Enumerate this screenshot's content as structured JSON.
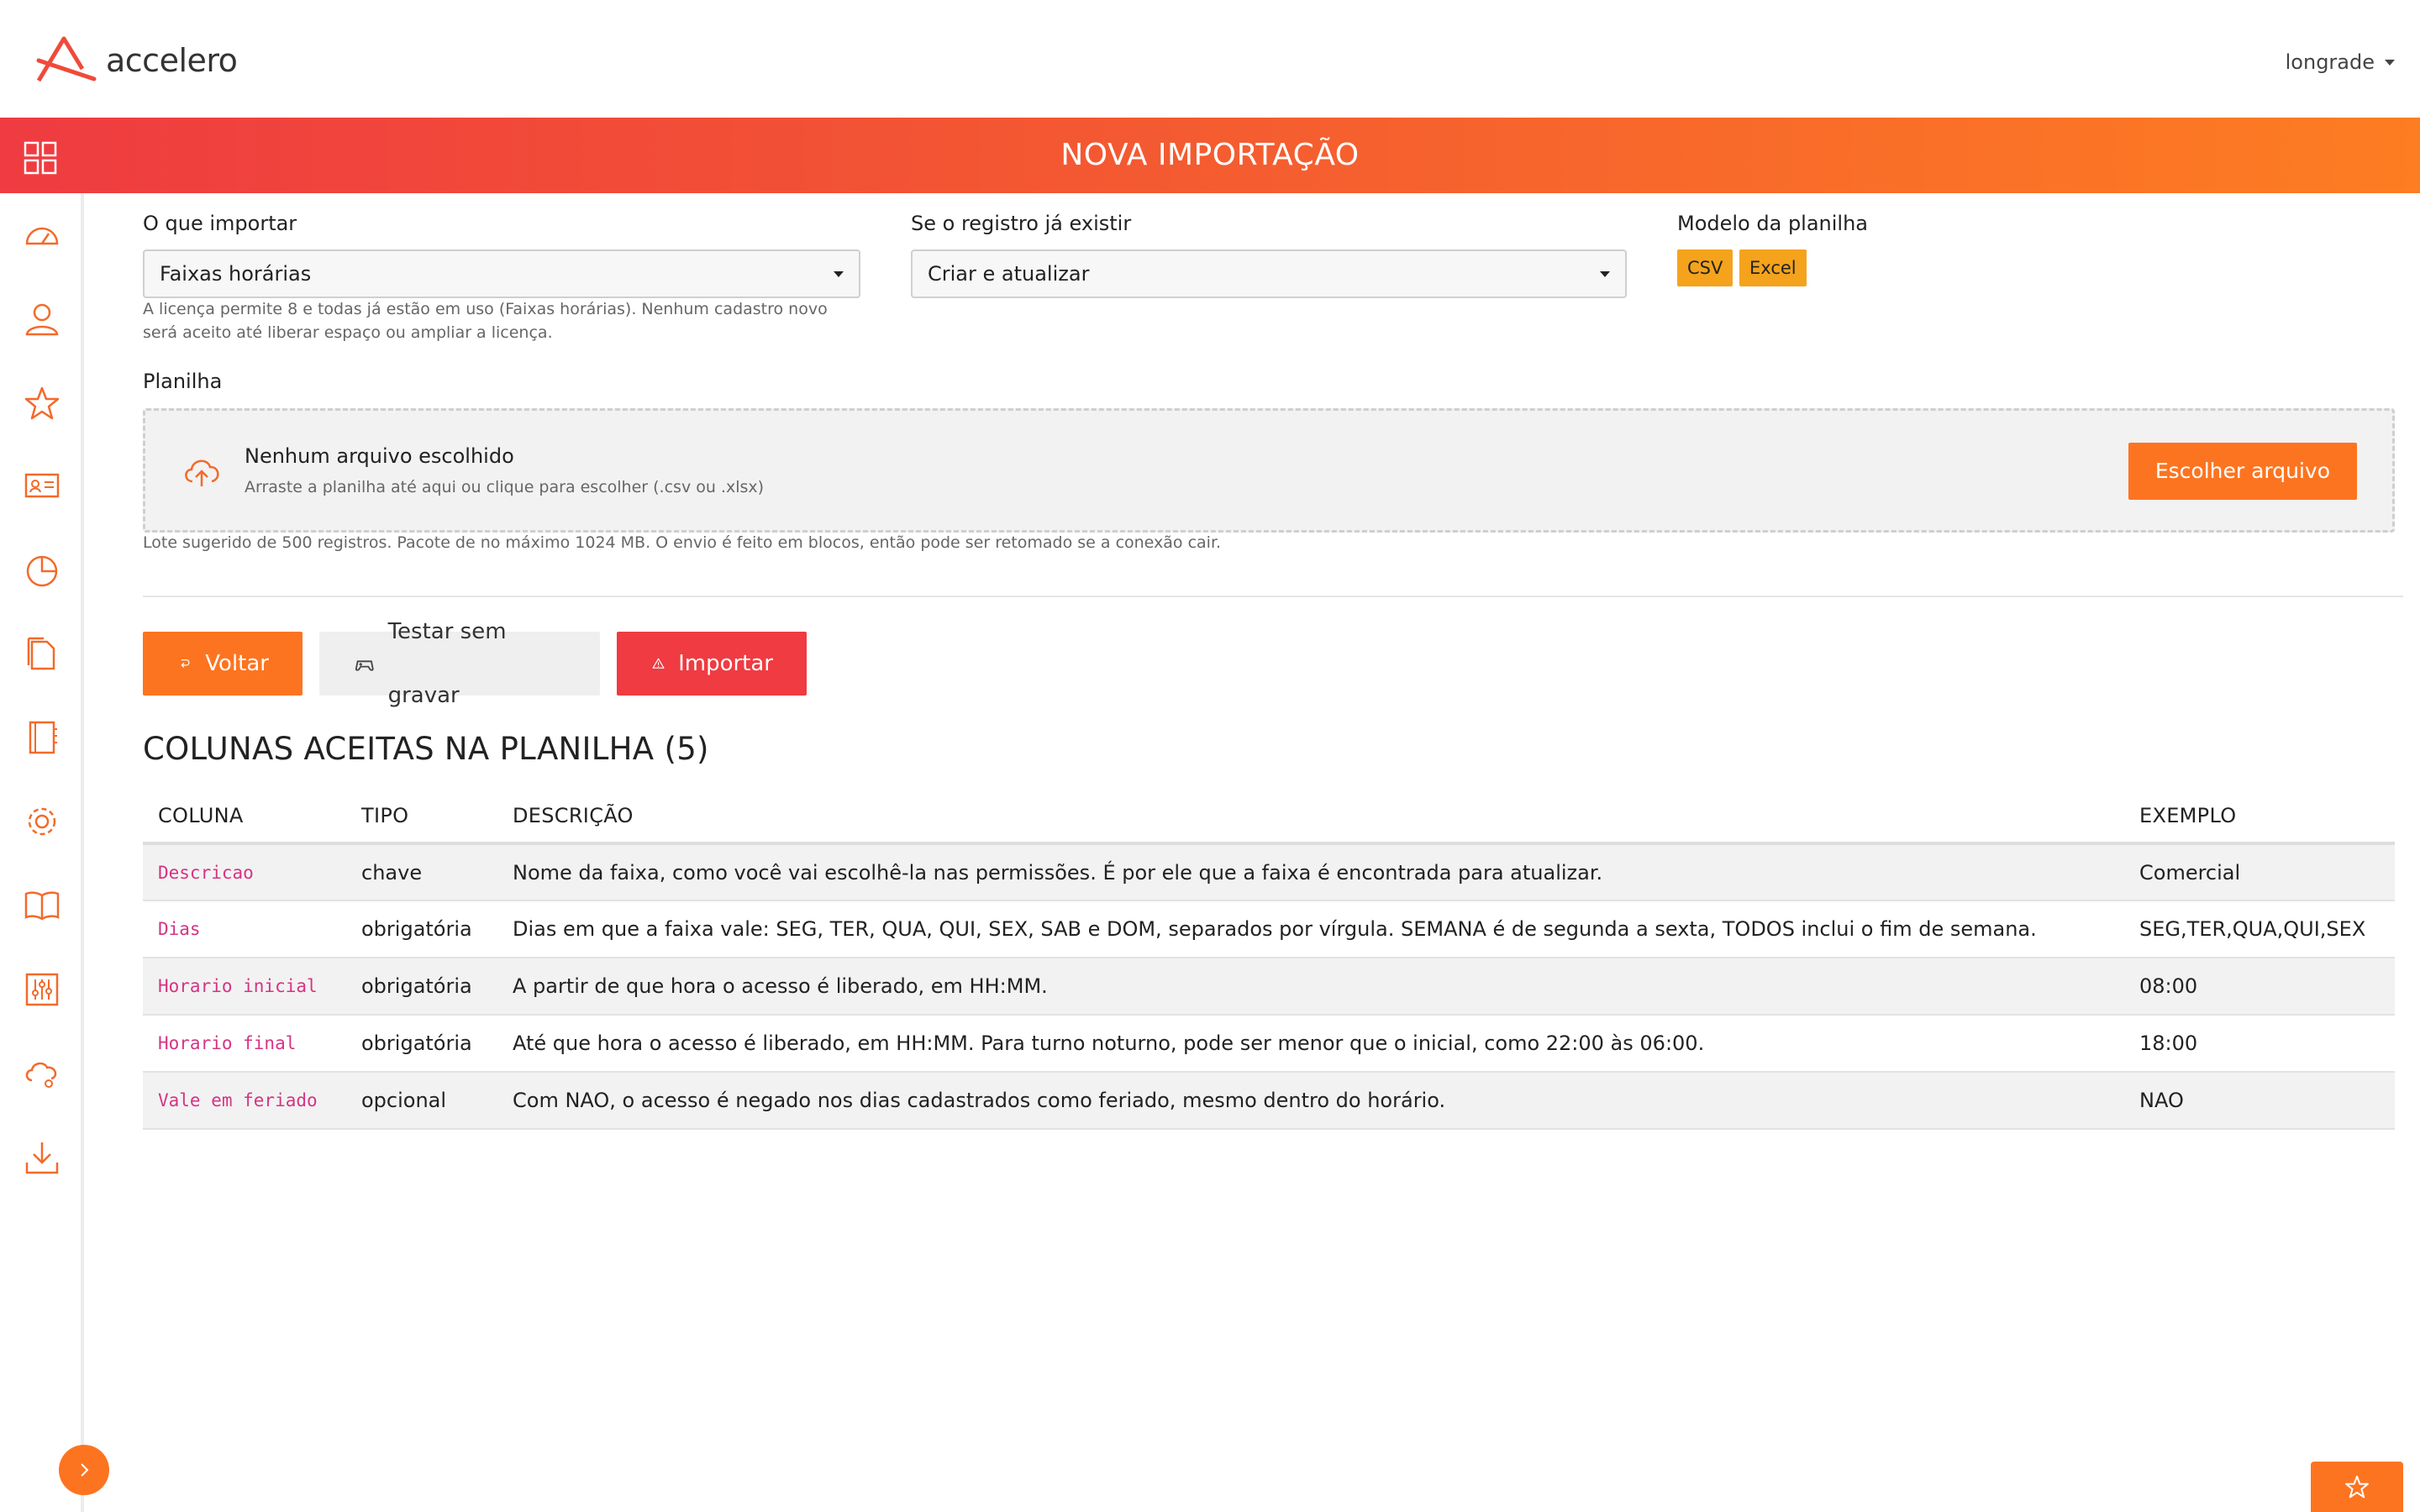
{
  "brand": {
    "name": "accelero",
    "accent": "#fd7420",
    "danger": "#ef3b41"
  },
  "user": {
    "name": "longrade"
  },
  "page": {
    "title": "NOVA IMPORTAÇÃO"
  },
  "sidebar": {
    "items": [
      {
        "icon": "dashboard-gauge-icon"
      },
      {
        "icon": "user-icon"
      },
      {
        "icon": "star-icon"
      },
      {
        "icon": "id-card-icon"
      },
      {
        "icon": "pie-chart-icon"
      },
      {
        "icon": "documents-icon"
      },
      {
        "icon": "notebook-icon"
      },
      {
        "icon": "gear-icon"
      },
      {
        "icon": "book-icon"
      },
      {
        "icon": "sliders-icon"
      },
      {
        "icon": "cloud-settings-icon"
      },
      {
        "icon": "download-icon"
      }
    ]
  },
  "form": {
    "what_label": "O que importar",
    "what_value": "Faixas horárias",
    "license_help": "A licença permite 8 e todas já estão em uso (Faixas horárias). Nenhum cadastro novo será aceito até liberar espaço ou ampliar a licença.",
    "exists_label": "Se o registro já existir",
    "exists_value": "Criar e atualizar",
    "template_label": "Modelo da planilha",
    "template_csv": "CSV",
    "template_excel": "Excel",
    "sheet_label": "Planilha",
    "dropzone_title": "Nenhum arquivo escolhido",
    "dropzone_sub": "Arraste a planilha até aqui ou clique para escolher (.csv ou .xlsx)",
    "choose_button": "Escolher arquivo",
    "upload_note": "Lote sugerido de 500 registros. Pacote de no máximo 1024 MB. O envio é feito em blocos, então pode ser retomado se a conexão cair."
  },
  "actions": {
    "back": "Voltar",
    "test": "Testar sem gravar",
    "import": "Importar"
  },
  "columns_section": {
    "title": "COLUNAS ACEITAS NA PLANILHA (5)",
    "headers": [
      "COLUNA",
      "TIPO",
      "DESCRIÇÃO",
      "EXEMPLO"
    ],
    "rows": [
      {
        "coluna": "Descricao",
        "tipo": "chave",
        "descricao": "Nome da faixa, como você vai escolhê-la nas permissões. É por ele que a faixa é encontrada para atualizar.",
        "exemplo": "Comercial"
      },
      {
        "coluna": "Dias",
        "tipo": "obrigatória",
        "descricao": "Dias em que a faixa vale: SEG, TER, QUA, QUI, SEX, SAB e DOM, separados por vírgula. SEMANA é de segunda a sexta, TODOS inclui o fim de semana.",
        "exemplo": "SEG,TER,QUA,QUI,SEX"
      },
      {
        "coluna": "Horario inicial",
        "tipo": "obrigatória",
        "descricao": "A partir de que hora o acesso é liberado, em HH:MM.",
        "exemplo": "08:00"
      },
      {
        "coluna": "Horario final",
        "tipo": "obrigatória",
        "descricao": "Até que hora o acesso é liberado, em HH:MM. Para turno noturno, pode ser menor que o inicial, como 22:00 às 06:00.",
        "exemplo": "18:00"
      },
      {
        "coluna": "Vale em feriado",
        "tipo": "opcional",
        "descricao": "Com NAO, o acesso é negado nos dias cadastrados como feriado, mesmo dentro do horário.",
        "exemplo": "NAO"
      }
    ]
  }
}
